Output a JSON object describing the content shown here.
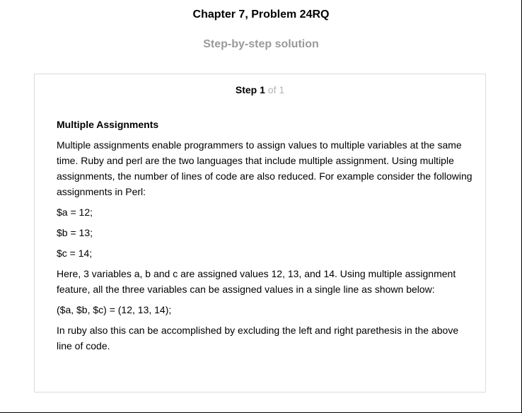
{
  "header": {
    "title": "Chapter 7, Problem 24RQ",
    "subtitle": "Step-by-step solution"
  },
  "step": {
    "label": "Step",
    "number": "1",
    "of_text": "of 1"
  },
  "solution": {
    "heading": "Multiple Assignments",
    "paragraphs": [
      "Multiple assignments enable programmers to assign values to multiple variables at the same time. Ruby and perl are the two languages that include multiple assignment. Using multiple assignments, the number of lines of code are also reduced. For example consider the following assignments in Perl:",
      "$a = 12;",
      "$b = 13;",
      "$c = 14;",
      "Here, 3 variables a, b and c are assigned values 12, 13, and 14. Using multiple assignment feature, all the three variables can be assigned values in a single line as shown below:",
      "($a, $b, $c) = (12, 13, 14);",
      "In ruby also this can be accomplished by excluding the left and right parethesis in the above line of code."
    ]
  }
}
